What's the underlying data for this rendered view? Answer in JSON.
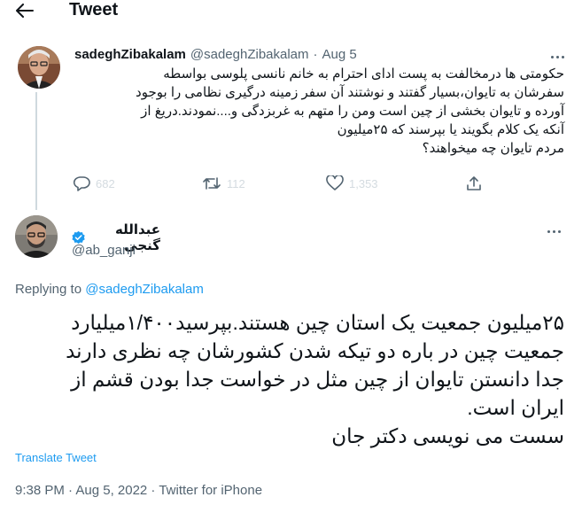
{
  "header": {
    "title": "Tweet"
  },
  "parent_tweet": {
    "author_name": "sadeghZibakalam",
    "author_handle": "@sadeghZibakalam",
    "separator": "·",
    "date": "Aug 5",
    "body_lines": [
      "حکومتی ها درمخالفت به پست ادای احترام به خانم نانسی پلوسی بواسطه",
      "سفرشان به تایوان،بسیار گفتند و نوشتند آن سفر زمینه درگیری نظامی را بوجود",
      "آورده و تایوان بخشی از چین است ومن را متهم به غربزدگی و....نمودند.دریغ از",
      "آنکه یک کلام بگویند یا بپرسند که ۲۵میلیون",
      "مردم تایوان چه میخواهند؟"
    ],
    "replies_count": "682",
    "retweets_count": "112",
    "likes_count": "1,353"
  },
  "main_tweet": {
    "author_name": "عبدالله گنجی",
    "author_handle": "@ab_ganji",
    "replying_prefix": "Replying to",
    "replying_to": "@sadeghZibakalam",
    "body_lines": [
      "۲۵میلیون جمعیت یک استان چین هستند.بپرسید۱/۴۰۰میلیارد",
      "جمعیت چین در باره دو تیکه شدن کشورشان چه نظری دارند",
      "جدا دانستن تایوان از چین مثل در خواست جدا بودن قشم از",
      "ایران است.",
      "سست می نویسی دکتر جان"
    ],
    "translate_label": "Translate Tweet",
    "timestamp": "9:38 PM · Aug 5, 2022 · Twitter for iPhone"
  },
  "icons": {
    "back": "arrow-left-icon",
    "more": "more-dots-icon",
    "reply": "reply-bubble-icon",
    "retweet": "retweet-icon",
    "like": "heart-icon",
    "share": "share-icon",
    "verified": "verified-badge-icon"
  },
  "colors": {
    "accent": "#1d9bf0",
    "text": "#0f1419",
    "secondary": "#536471",
    "thread_line": "#cfd9de"
  }
}
